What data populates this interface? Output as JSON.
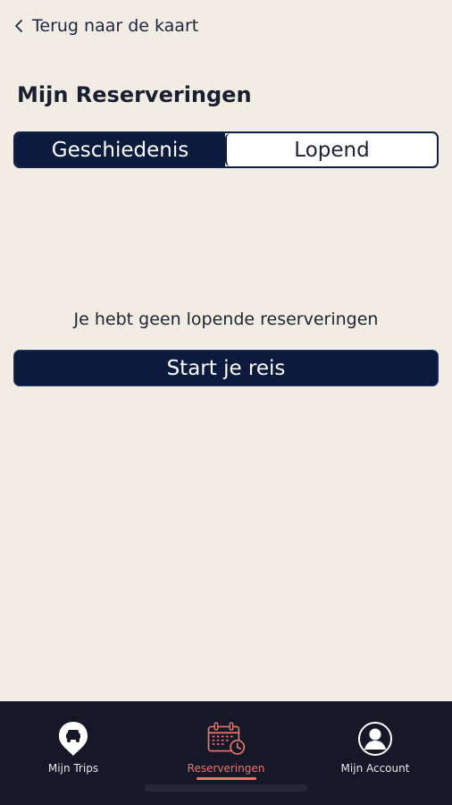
{
  "header": {
    "back_label": "Terug naar de kaart",
    "title": "Mijn Reserveringen"
  },
  "segmented": {
    "tabs": [
      {
        "label": "Geschiedenis",
        "active": true
      },
      {
        "label": "Lopend",
        "active": false
      }
    ]
  },
  "main": {
    "empty_message": "Je hebt geen lopende reserveringen",
    "start_button_label": "Start je reis"
  },
  "tabbar": {
    "items": [
      {
        "label": "Mijn Trips",
        "icon": "map-pin-car-icon",
        "active": false
      },
      {
        "label": "Reserveringen",
        "icon": "calendar-clock-icon",
        "active": true
      },
      {
        "label": "Mijn Account",
        "icon": "user-circle-icon",
        "active": false
      }
    ]
  },
  "colors": {
    "background": "#f1ece4",
    "navy": "#0b1a3d",
    "tabbar": "#161827",
    "accent": "#e9766d"
  }
}
